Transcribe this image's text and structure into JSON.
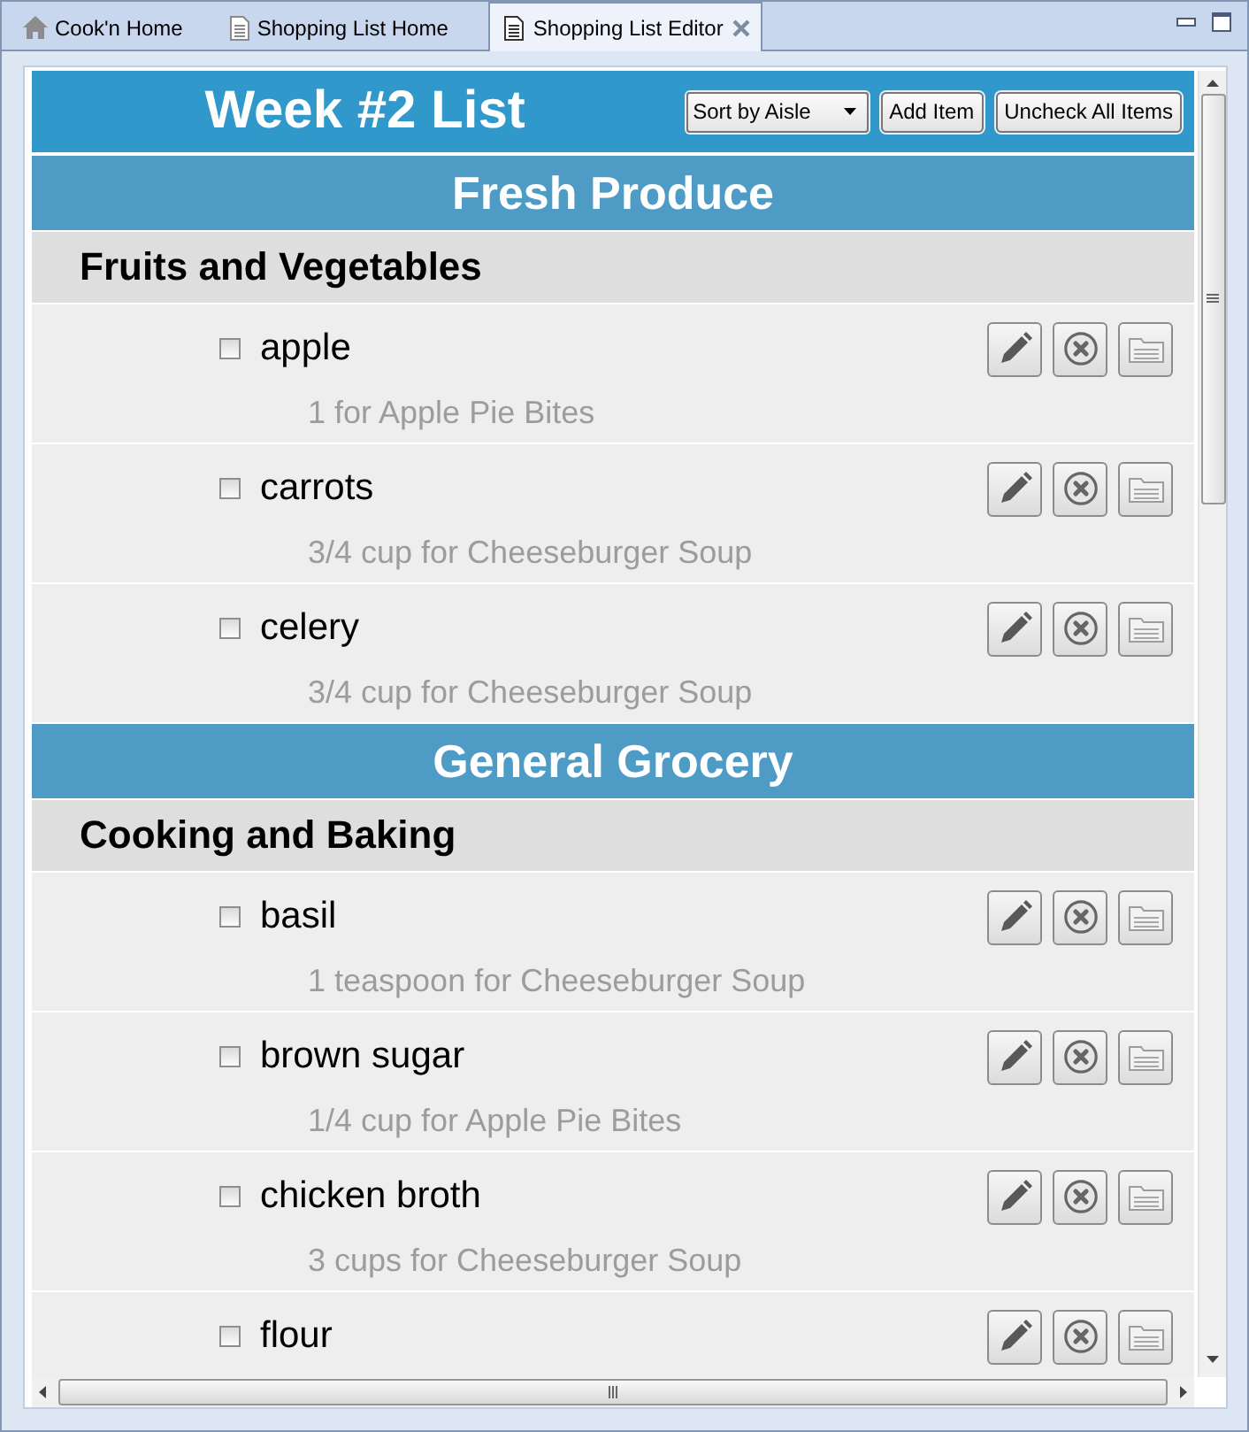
{
  "tabs": [
    {
      "kind": "home",
      "label": "Cook'n Home",
      "selected": false
    },
    {
      "kind": "page",
      "label": "Shopping List Home",
      "selected": false
    },
    {
      "kind": "page",
      "label": "Shopping List Editor",
      "selected": true
    }
  ],
  "list": {
    "title": "Week #2 List",
    "sort_dropdown": {
      "value": "Sort by Aisle"
    },
    "buttons": [
      "Add Item",
      "Uncheck All Items"
    ]
  },
  "sections": [
    {
      "title": "Fresh Produce",
      "categories": [
        {
          "title": "Fruits and Vegetables",
          "items": [
            {
              "name": "apple",
              "checked": false,
              "detail": "1 for Apple Pie Bites"
            },
            {
              "name": "carrots",
              "checked": false,
              "detail": "3/4 cup for Cheeseburger Soup"
            },
            {
              "name": "celery",
              "checked": false,
              "detail": "3/4 cup for Cheeseburger Soup"
            }
          ]
        }
      ]
    },
    {
      "title": "General Grocery",
      "categories": [
        {
          "title": "Cooking and Baking",
          "items": [
            {
              "name": "basil",
              "checked": false,
              "detail": "1 teaspoon for Cheeseburger Soup"
            },
            {
              "name": "brown sugar",
              "checked": false,
              "detail": "1/4 cup for Apple Pie Bites"
            },
            {
              "name": "chicken broth",
              "checked": false,
              "detail": "3 cups for Cheeseburger Soup"
            },
            {
              "name": "flour",
              "checked": false
            }
          ]
        }
      ]
    }
  ]
}
